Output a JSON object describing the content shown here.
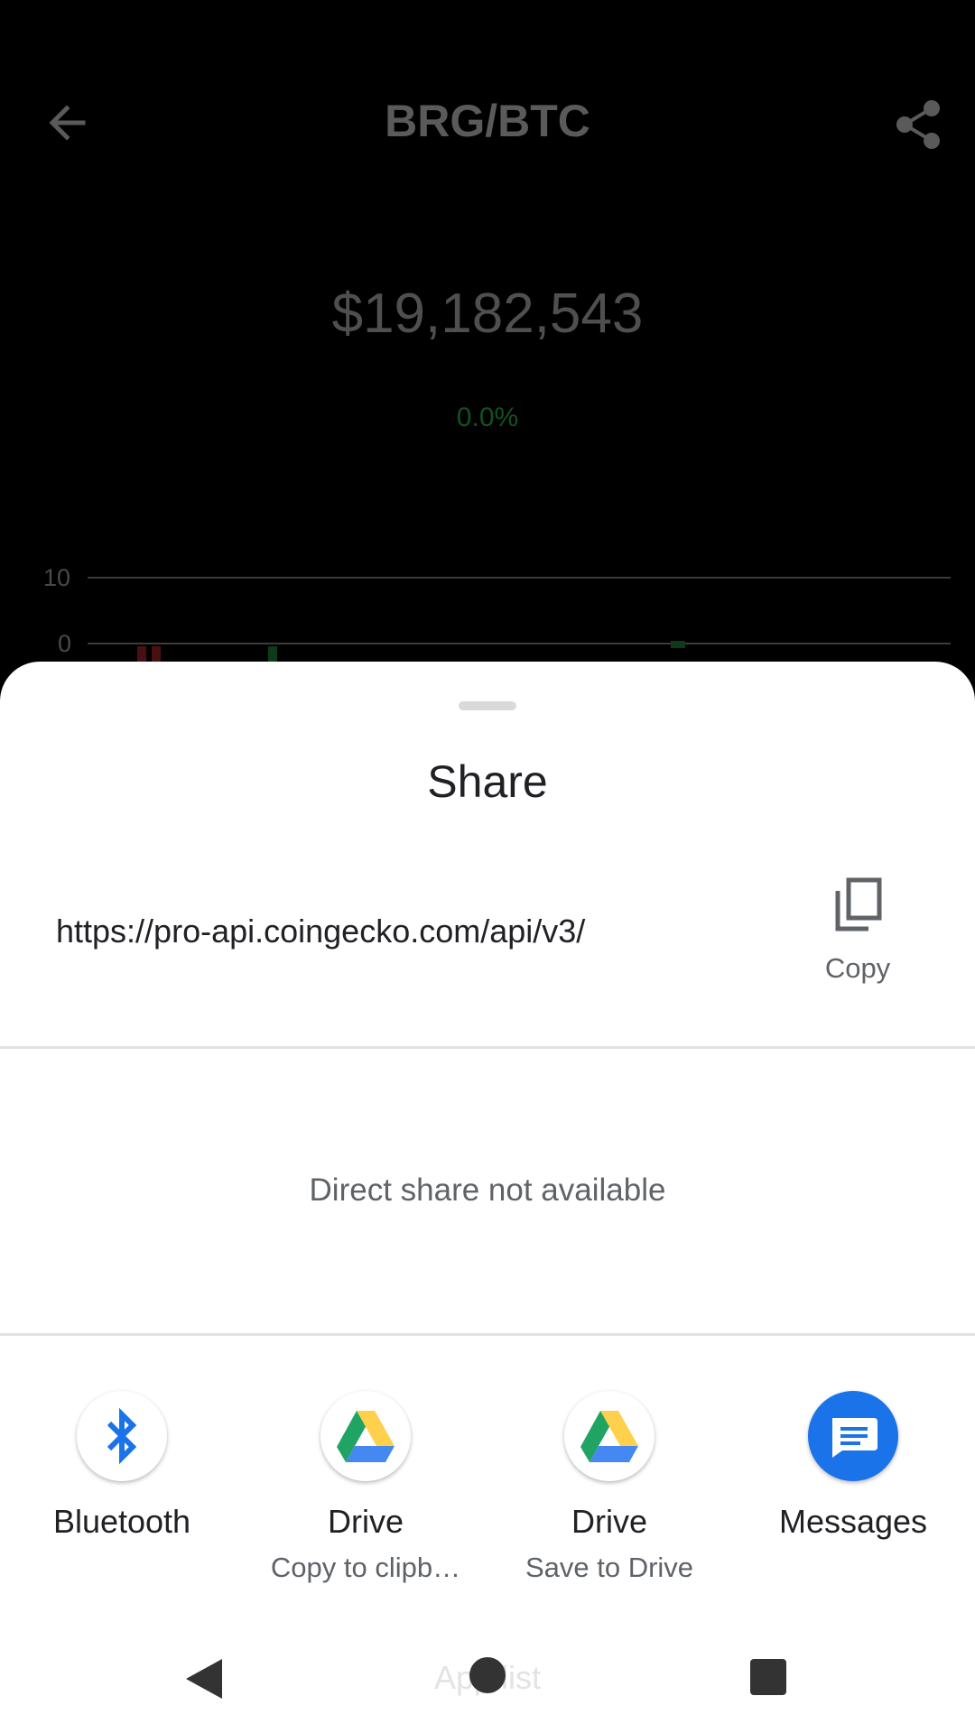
{
  "app": {
    "title": "BRG/BTC",
    "price": "$19,182,543",
    "change": "0.0%",
    "chart_ticks": [
      "10",
      "0"
    ]
  },
  "share_sheet": {
    "title": "Share",
    "url": "https://pro-api.coingecko.com/api/v3/",
    "copy_label": "Copy",
    "direct_share_message": "Direct share not available",
    "targets": [
      {
        "label": "Bluetooth",
        "sub": "",
        "icon": "bluetooth-icon"
      },
      {
        "label": "Drive",
        "sub": "Copy to clipb…",
        "icon": "drive-icon"
      },
      {
        "label": "Drive",
        "sub": "Save to Drive",
        "icon": "drive-icon"
      },
      {
        "label": "Messages",
        "sub": "",
        "icon": "messages-icon"
      }
    ]
  },
  "navbar": {
    "ghost_label": "App list"
  },
  "colors": {
    "accent_blue": "#1a73e8",
    "price_change_green": "#13511f",
    "drive_green": "#1fa463",
    "drive_yellow": "#ffd04b",
    "drive_blue": "#4688f1"
  }
}
